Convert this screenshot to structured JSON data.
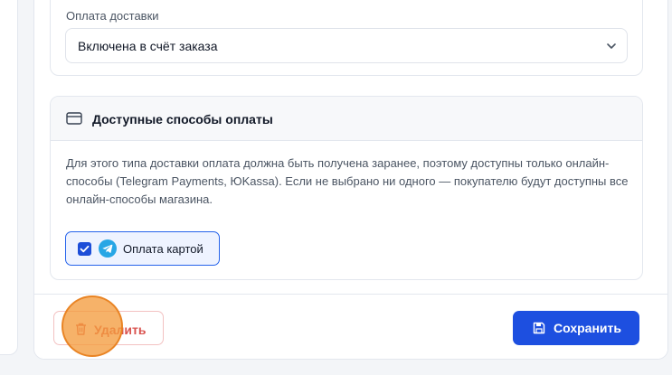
{
  "delivery": {
    "payment_label": "Оплата доставки",
    "payment_selected": "Включена в счёт заказа"
  },
  "payment_methods": {
    "title": "Доступные способы оплаты",
    "description": "Для этого типа доставки оплата должна быть получена заранее, поэтому доступны только онлайн-способы (Telegram Payments, ЮKassa). Если не выбрано ни одного — покупателю будут доступны все онлайн-способы магазина.",
    "items": [
      {
        "label": "Оплата картой",
        "checked": true,
        "icon": "telegram-icon"
      }
    ]
  },
  "footer": {
    "delete_label": "Удалить",
    "save_label": "Сохранить"
  },
  "colors": {
    "accent": "#1d4fe0",
    "danger": "#d9534f",
    "click_indicator": "#f39c3f"
  }
}
